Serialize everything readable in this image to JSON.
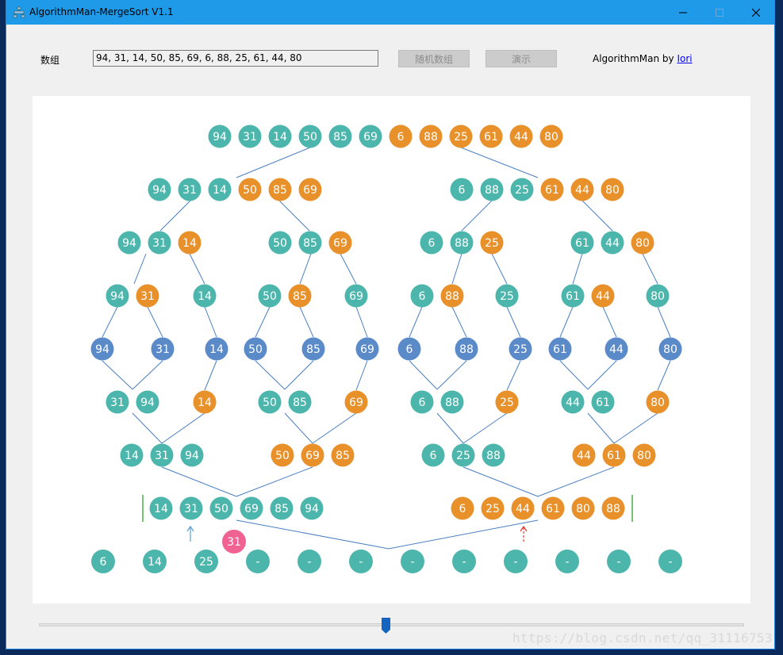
{
  "window": {
    "title": "AlgorithmMan-MergeSort V1.1",
    "controls": [
      "minimize-icon",
      "maximize-icon",
      "close-icon"
    ]
  },
  "toolbar": {
    "array_label": "数组",
    "array_value": "94, 31, 14, 50, 85, 69, 6, 88, 25, 61, 44, 80",
    "random_button": "随机数组",
    "demo_button": "演示",
    "credit_prefix": "AlgorithmMan by ",
    "credit_link": "Iori"
  },
  "colors": {
    "teal": "#4db6ac",
    "orange": "#e8902a",
    "blue": "#5b8ac9",
    "pink": "#f06292",
    "line": "#4a7fc1",
    "pointer_blue": "#5a9fd4",
    "pointer_red": "#e53935",
    "marker_green": "#2aa52a"
  },
  "visualization": {
    "rows": [
      [
        [
          "94",
          "t"
        ],
        [
          "31",
          "t"
        ],
        [
          "14",
          "t"
        ],
        [
          "50",
          "t"
        ],
        [
          "85",
          "t"
        ],
        [
          "69",
          "t"
        ],
        [
          "6",
          "o"
        ],
        [
          "88",
          "o"
        ],
        [
          "25",
          "o"
        ],
        [
          "61",
          "o"
        ],
        [
          "44",
          "o"
        ],
        [
          "80",
          "o"
        ]
      ],
      [
        [
          "94",
          "t"
        ],
        [
          "31",
          "t"
        ],
        [
          "14",
          "t"
        ],
        [
          "50",
          "o"
        ],
        [
          "85",
          "o"
        ],
        [
          "69",
          "o"
        ],
        [
          "6",
          "t"
        ],
        [
          "88",
          "t"
        ],
        [
          "25",
          "t"
        ],
        [
          "61",
          "o"
        ],
        [
          "44",
          "o"
        ],
        [
          "80",
          "o"
        ]
      ],
      [
        [
          "94",
          "t"
        ],
        [
          "31",
          "t"
        ],
        [
          "14",
          "o"
        ],
        [
          "50",
          "t"
        ],
        [
          "85",
          "t"
        ],
        [
          "69",
          "o"
        ],
        [
          "6",
          "t"
        ],
        [
          "88",
          "t"
        ],
        [
          "25",
          "o"
        ],
        [
          "61",
          "t"
        ],
        [
          "44",
          "t"
        ],
        [
          "80",
          "o"
        ]
      ],
      [
        [
          "94",
          "t"
        ],
        [
          "31",
          "o"
        ],
        [
          "14",
          "t"
        ],
        [
          "50",
          "t"
        ],
        [
          "85",
          "o"
        ],
        [
          "69",
          "t"
        ],
        [
          "6",
          "t"
        ],
        [
          "88",
          "o"
        ],
        [
          "25",
          "t"
        ],
        [
          "61",
          "t"
        ],
        [
          "44",
          "o"
        ],
        [
          "80",
          "t"
        ]
      ],
      [
        [
          "94",
          "b"
        ],
        [
          "31",
          "b"
        ],
        [
          "14",
          "b"
        ],
        [
          "50",
          "b"
        ],
        [
          "85",
          "b"
        ],
        [
          "69",
          "b"
        ],
        [
          "6",
          "b"
        ],
        [
          "88",
          "b"
        ],
        [
          "25",
          "b"
        ],
        [
          "61",
          "b"
        ],
        [
          "44",
          "b"
        ],
        [
          "80",
          "b"
        ]
      ],
      [
        [
          "31",
          "t"
        ],
        [
          "94",
          "t"
        ],
        [
          "14",
          "o"
        ],
        [
          "50",
          "t"
        ],
        [
          "85",
          "t"
        ],
        [
          "69",
          "o"
        ],
        [
          "6",
          "t"
        ],
        [
          "88",
          "t"
        ],
        [
          "25",
          "o"
        ],
        [
          "44",
          "t"
        ],
        [
          "61",
          "t"
        ],
        [
          "80",
          "o"
        ]
      ],
      [
        [
          "14",
          "t"
        ],
        [
          "31",
          "t"
        ],
        [
          "94",
          "t"
        ],
        [
          "50",
          "o"
        ],
        [
          "69",
          "o"
        ],
        [
          "85",
          "o"
        ],
        [
          "6",
          "t"
        ],
        [
          "25",
          "t"
        ],
        [
          "88",
          "t"
        ],
        [
          "44",
          "o"
        ],
        [
          "61",
          "o"
        ],
        [
          "80",
          "o"
        ]
      ],
      [
        [
          "14",
          "t"
        ],
        [
          "31",
          "t"
        ],
        [
          "50",
          "t"
        ],
        [
          "69",
          "t"
        ],
        [
          "85",
          "t"
        ],
        [
          "94",
          "t"
        ],
        [
          "6",
          "o"
        ],
        [
          "25",
          "o"
        ],
        [
          "44",
          "o"
        ],
        [
          "61",
          "o"
        ],
        [
          "80",
          "o"
        ],
        [
          "88",
          "o"
        ]
      ],
      [
        [
          "6",
          "t"
        ],
        [
          "14",
          "t"
        ],
        [
          "25",
          "t"
        ],
        [
          "-",
          "t"
        ],
        [
          "-",
          "t"
        ],
        [
          "-",
          "t"
        ],
        [
          "-",
          "t"
        ],
        [
          "-",
          "t"
        ],
        [
          "-",
          "t"
        ],
        [
          "-",
          "t"
        ],
        [
          "-",
          "t"
        ],
        [
          "-",
          "t"
        ]
      ]
    ],
    "floating_value": "31",
    "left_pointer": "↑",
    "right_pointer": "↑"
  },
  "slider": {
    "position_fraction": 0.5
  },
  "watermark": "https://blog.csdn.net/qq_31116753"
}
